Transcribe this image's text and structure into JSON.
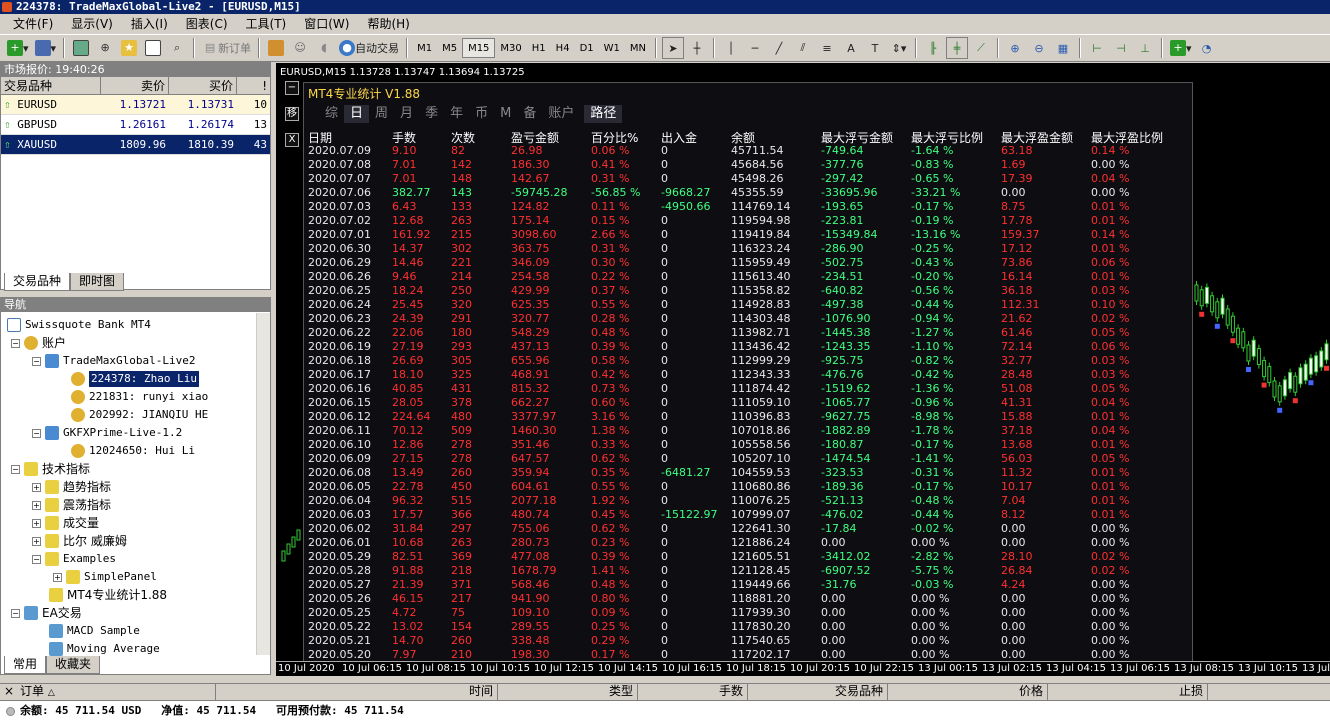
{
  "window": {
    "title": "224378: TradeMaxGlobal-Live2 - [EURUSD,M15]"
  },
  "menu": [
    "文件(F)",
    "显示(V)",
    "插入(I)",
    "图表(C)",
    "工具(T)",
    "窗口(W)",
    "帮助(H)"
  ],
  "toolbar": {
    "new_order": "新订单",
    "auto_trading": "自动交易",
    "timeframes": [
      "M1",
      "M5",
      "M15",
      "M30",
      "H1",
      "H4",
      "D1",
      "W1",
      "MN"
    ],
    "active_timeframe": "M15"
  },
  "market_watch": {
    "title": "市场报价: 19:40:26",
    "columns": [
      "交易品种",
      "卖价",
      "买价",
      "!"
    ],
    "rows": [
      {
        "symbol": "EURUSD",
        "bid": "1.13721",
        "ask": "1.13731",
        "spread": "10",
        "dir": "up"
      },
      {
        "symbol": "GBPUSD",
        "bid": "1.26161",
        "ask": "1.26174",
        "spread": "13",
        "dir": "up"
      },
      {
        "symbol": "XAUUSD",
        "bid": "1809.96",
        "ask": "1810.39",
        "spread": "43",
        "dir": "up"
      }
    ],
    "tabs": [
      "交易品种",
      "即时图"
    ]
  },
  "navigator": {
    "title": "导航",
    "items": [
      "Swissquote Bank MT4",
      "账户",
      "TradeMaxGlobal-Live2",
      "224378: Zhao Liu",
      "221831: runyi xiao",
      "202992: JIANQIU HE",
      "GKFXPrime-Live-1.2",
      "12024650: Hui  Li",
      "技术指标",
      "趋势指标",
      "震荡指标",
      "成交量",
      "比尔 威廉姆",
      "Examples",
      "SimplePanel",
      "MT4专业统计1.88",
      "EA交易",
      "MACD Sample",
      "Moving Average"
    ],
    "tabs": [
      "常用",
      "收藏夹"
    ]
  },
  "chart": {
    "header": "EURUSD,M15  1.13728 1.13747 1.13694 1.13725",
    "side_buttons": [
      "−",
      "移",
      "X"
    ],
    "time_labels": [
      "10 Jul 2020",
      "10 Jul 06:15",
      "10 Jul 08:15",
      "10 Jul 10:15",
      "10 Jul 12:15",
      "10 Jul 14:15",
      "10 Jul 16:15",
      "10 Jul 18:15",
      "10 Jul 20:15",
      "10 Jul 22:15",
      "13 Jul 00:15",
      "13 Jul 02:15",
      "13 Jul 04:15",
      "13 Jul 06:15",
      "13 Jul 08:15",
      "13 Jul 10:15",
      "13 Jul"
    ]
  },
  "stats": {
    "title": "MT4专业统计 V1.88",
    "tabs": [
      "综",
      "日",
      "周",
      "月",
      "季",
      "年",
      "币",
      "M",
      "备",
      "账户"
    ],
    "active_tab": "日",
    "path_tab": "路径",
    "columns": [
      "日期",
      "手数",
      "次数",
      "盈亏金额",
      "百分比%",
      "出入金",
      "余额",
      "最大浮亏金额",
      "最大浮亏比例",
      "最大浮盈金额",
      "最大浮盈比例"
    ],
    "rows": [
      [
        "2020.07.09",
        "9.10",
        "82",
        "26.98",
        "0.06 %",
        "0",
        "45711.54",
        "-749.64",
        "-1.64 %",
        "63.18",
        "0.14 %"
      ],
      [
        "2020.07.08",
        "7.01",
        "142",
        "186.30",
        "0.41 %",
        "0",
        "45684.56",
        "-377.76",
        "-0.83 %",
        "1.69",
        "0.00 %"
      ],
      [
        "2020.07.07",
        "7.01",
        "148",
        "142.67",
        "0.31 %",
        "0",
        "45498.26",
        "-297.42",
        "-0.65 %",
        "17.39",
        "0.04 %"
      ],
      [
        "2020.07.06",
        "382.77",
        "143",
        "-59745.28",
        "-56.85 %",
        "-9668.27",
        "45355.59",
        "-33695.96",
        "-33.21 %",
        "0.00",
        "0.00 %"
      ],
      [
        "2020.07.03",
        "6.43",
        "133",
        "124.82",
        "0.11 %",
        "-4950.66",
        "114769.14",
        "-193.65",
        "-0.17 %",
        "8.75",
        "0.01 %"
      ],
      [
        "2020.07.02",
        "12.68",
        "263",
        "175.14",
        "0.15 %",
        "0",
        "119594.98",
        "-223.81",
        "-0.19 %",
        "17.78",
        "0.01 %"
      ],
      [
        "2020.07.01",
        "161.92",
        "215",
        "3098.60",
        "2.66 %",
        "0",
        "119419.84",
        "-15349.84",
        "-13.16 %",
        "159.37",
        "0.14 %"
      ],
      [
        "2020.06.30",
        "14.37",
        "302",
        "363.75",
        "0.31 %",
        "0",
        "116323.24",
        "-286.90",
        "-0.25 %",
        "17.12",
        "0.01 %"
      ],
      [
        "2020.06.29",
        "14.46",
        "221",
        "346.09",
        "0.30 %",
        "0",
        "115959.49",
        "-502.75",
        "-0.43 %",
        "73.86",
        "0.06 %"
      ],
      [
        "2020.06.26",
        "9.46",
        "214",
        "254.58",
        "0.22 %",
        "0",
        "115613.40",
        "-234.51",
        "-0.20 %",
        "16.14",
        "0.01 %"
      ],
      [
        "2020.06.25",
        "18.24",
        "250",
        "429.99",
        "0.37 %",
        "0",
        "115358.82",
        "-640.82",
        "-0.56 %",
        "36.18",
        "0.03 %"
      ],
      [
        "2020.06.24",
        "25.45",
        "320",
        "625.35",
        "0.55 %",
        "0",
        "114928.83",
        "-497.38",
        "-0.44 %",
        "112.31",
        "0.10 %"
      ],
      [
        "2020.06.23",
        "24.39",
        "291",
        "320.77",
        "0.28 %",
        "0",
        "114303.48",
        "-1076.90",
        "-0.94 %",
        "21.62",
        "0.02 %"
      ],
      [
        "2020.06.22",
        "22.06",
        "180",
        "548.29",
        "0.48 %",
        "0",
        "113982.71",
        "-1445.38",
        "-1.27 %",
        "61.46",
        "0.05 %"
      ],
      [
        "2020.06.19",
        "27.19",
        "293",
        "437.13",
        "0.39 %",
        "0",
        "113436.42",
        "-1243.35",
        "-1.10 %",
        "72.14",
        "0.06 %"
      ],
      [
        "2020.06.18",
        "26.69",
        "305",
        "655.96",
        "0.58 %",
        "0",
        "112999.29",
        "-925.75",
        "-0.82 %",
        "32.77",
        "0.03 %"
      ],
      [
        "2020.06.17",
        "18.10",
        "325",
        "468.91",
        "0.42 %",
        "0",
        "112343.33",
        "-476.76",
        "-0.42 %",
        "28.48",
        "0.03 %"
      ],
      [
        "2020.06.16",
        "40.85",
        "431",
        "815.32",
        "0.73 %",
        "0",
        "111874.42",
        "-1519.62",
        "-1.36 %",
        "51.08",
        "0.05 %"
      ],
      [
        "2020.06.15",
        "28.05",
        "378",
        "662.27",
        "0.60 %",
        "0",
        "111059.10",
        "-1065.77",
        "-0.96 %",
        "41.31",
        "0.04 %"
      ],
      [
        "2020.06.12",
        "224.64",
        "480",
        "3377.97",
        "3.16 %",
        "0",
        "110396.83",
        "-9627.75",
        "-8.98 %",
        "15.88",
        "0.01 %"
      ],
      [
        "2020.06.11",
        "70.12",
        "509",
        "1460.30",
        "1.38 %",
        "0",
        "107018.86",
        "-1882.89",
        "-1.78 %",
        "37.18",
        "0.04 %"
      ],
      [
        "2020.06.10",
        "12.86",
        "278",
        "351.46",
        "0.33 %",
        "0",
        "105558.56",
        "-180.87",
        "-0.17 %",
        "13.68",
        "0.01 %"
      ],
      [
        "2020.06.09",
        "27.15",
        "278",
        "647.57",
        "0.62 %",
        "0",
        "105207.10",
        "-1474.54",
        "-1.41 %",
        "56.03",
        "0.05 %"
      ],
      [
        "2020.06.08",
        "13.49",
        "260",
        "359.94",
        "0.35 %",
        "-6481.27",
        "104559.53",
        "-323.53",
        "-0.31 %",
        "11.32",
        "0.01 %"
      ],
      [
        "2020.06.05",
        "22.78",
        "450",
        "604.61",
        "0.55 %",
        "0",
        "110680.86",
        "-189.36",
        "-0.17 %",
        "10.17",
        "0.01 %"
      ],
      [
        "2020.06.04",
        "96.32",
        "515",
        "2077.18",
        "1.92 %",
        "0",
        "110076.25",
        "-521.13",
        "-0.48 %",
        "7.04",
        "0.01 %"
      ],
      [
        "2020.06.03",
        "17.57",
        "366",
        "480.74",
        "0.45 %",
        "-15122.97",
        "107999.07",
        "-476.02",
        "-0.44 %",
        "8.12",
        "0.01 %"
      ],
      [
        "2020.06.02",
        "31.84",
        "297",
        "755.06",
        "0.62 %",
        "0",
        "122641.30",
        "-17.84",
        "-0.02 %",
        "0.00",
        "0.00 %"
      ],
      [
        "2020.06.01",
        "10.68",
        "263",
        "280.73",
        "0.23 %",
        "0",
        "121886.24",
        "0.00",
        "0.00 %",
        "0.00",
        "0.00 %"
      ],
      [
        "2020.05.29",
        "82.51",
        "369",
        "477.08",
        "0.39 %",
        "0",
        "121605.51",
        "-3412.02",
        "-2.82 %",
        "28.10",
        "0.02 %"
      ],
      [
        "2020.05.28",
        "91.88",
        "218",
        "1678.79",
        "1.41 %",
        "0",
        "121128.45",
        "-6907.52",
        "-5.75 %",
        "26.84",
        "0.02 %"
      ],
      [
        "2020.05.27",
        "21.39",
        "371",
        "568.46",
        "0.48 %",
        "0",
        "119449.66",
        "-31.76",
        "-0.03 %",
        "4.24",
        "0.00 %"
      ],
      [
        "2020.05.26",
        "46.15",
        "217",
        "941.90",
        "0.80 %",
        "0",
        "118881.20",
        "0.00",
        "0.00 %",
        "0.00",
        "0.00 %"
      ],
      [
        "2020.05.25",
        "4.72",
        "75",
        "109.10",
        "0.09 %",
        "0",
        "117939.30",
        "0.00",
        "0.00 %",
        "0.00",
        "0.00 %"
      ],
      [
        "2020.05.22",
        "13.02",
        "154",
        "289.55",
        "0.25 %",
        "0",
        "117830.20",
        "0.00",
        "0.00 %",
        "0.00",
        "0.00 %"
      ],
      [
        "2020.05.21",
        "14.70",
        "260",
        "338.48",
        "0.29 %",
        "0",
        "117540.65",
        "0.00",
        "0.00 %",
        "0.00",
        "0.00 %"
      ],
      [
        "2020.05.20",
        "7.97",
        "210",
        "198.30",
        "0.17 %",
        "0",
        "117202.17",
        "0.00",
        "0.00 %",
        "0.00",
        "0.00 %"
      ]
    ]
  },
  "orders": {
    "columns": [
      "订单",
      "时间",
      "类型",
      "手数",
      "交易品种",
      "价格",
      "止损"
    ]
  },
  "status": {
    "balance_label": "余额:",
    "balance": "45 711.54 USD",
    "equity_label": "净值:",
    "equity": "45 711.54",
    "free_margin_label": "可用预付款:",
    "free_margin": "45 711.54"
  },
  "colors": {
    "loss": "#ff3030",
    "profit": "#40ff80",
    "title": "#ffd84a",
    "selection": "#0a246a"
  }
}
